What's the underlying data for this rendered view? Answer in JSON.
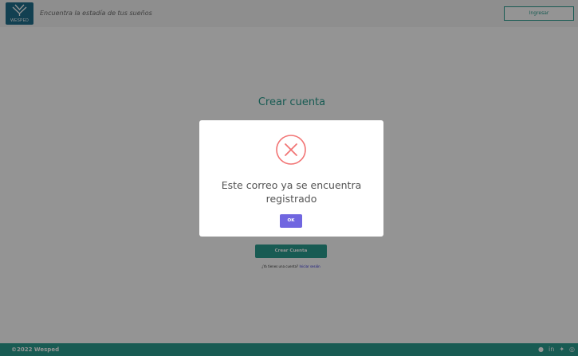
{
  "header": {
    "logo_text": "WESPED",
    "tagline": "Encuentra la estadía de tus sueños",
    "login_label": "Ingresar"
  },
  "main": {
    "title": "Crear cuenta",
    "create_button_label": "Crear Cuenta",
    "have_account_text": "¿Ya tienes una cuenta?",
    "login_link_text": "Iniciar sesión"
  },
  "modal": {
    "icon": "error-x-icon",
    "message": "Este correo ya se encuentra registrado",
    "ok_label": "OK"
  },
  "footer": {
    "copyright": "©2022 Wesped",
    "social_icons": [
      "facebook-icon",
      "linkedin-icon",
      "twitter-icon",
      "instagram-icon"
    ]
  },
  "colors": {
    "brand": "#2a9d8f",
    "logo_bg": "#1f6e8c",
    "error": "#f27474",
    "ok_button": "#7066e0"
  }
}
